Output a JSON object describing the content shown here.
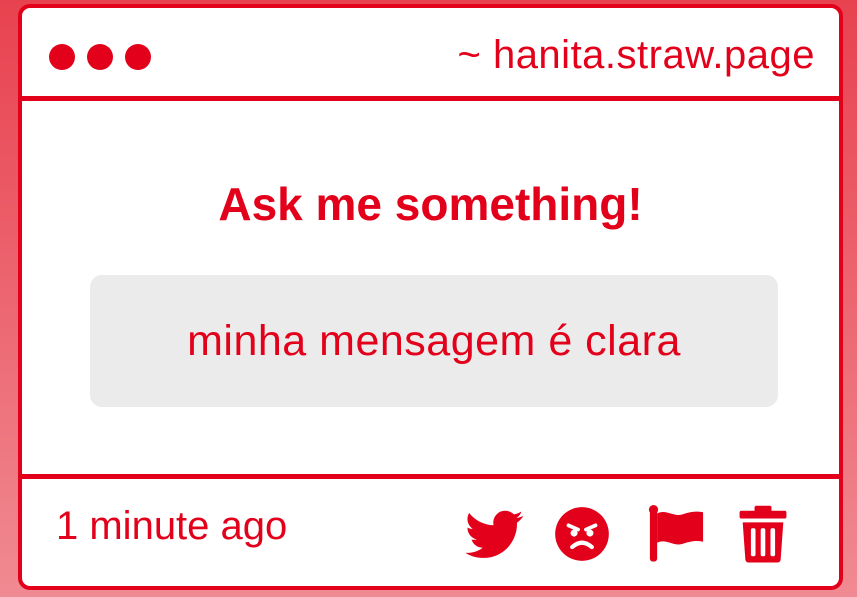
{
  "window": {
    "url": "~ hanita.straw.page"
  },
  "content": {
    "heading": "Ask me something!",
    "message": "minha mensagem é clara"
  },
  "footer": {
    "timestamp": "1 minute ago",
    "actions": [
      {
        "icon": "twitter-icon"
      },
      {
        "icon": "angry-face-icon"
      },
      {
        "icon": "flag-icon"
      },
      {
        "icon": "trash-icon"
      }
    ]
  },
  "colors": {
    "accent": "#e2001a",
    "message_bg": "#ecebec",
    "background_top": "#e8424f",
    "background_bottom": "#f08a92"
  }
}
